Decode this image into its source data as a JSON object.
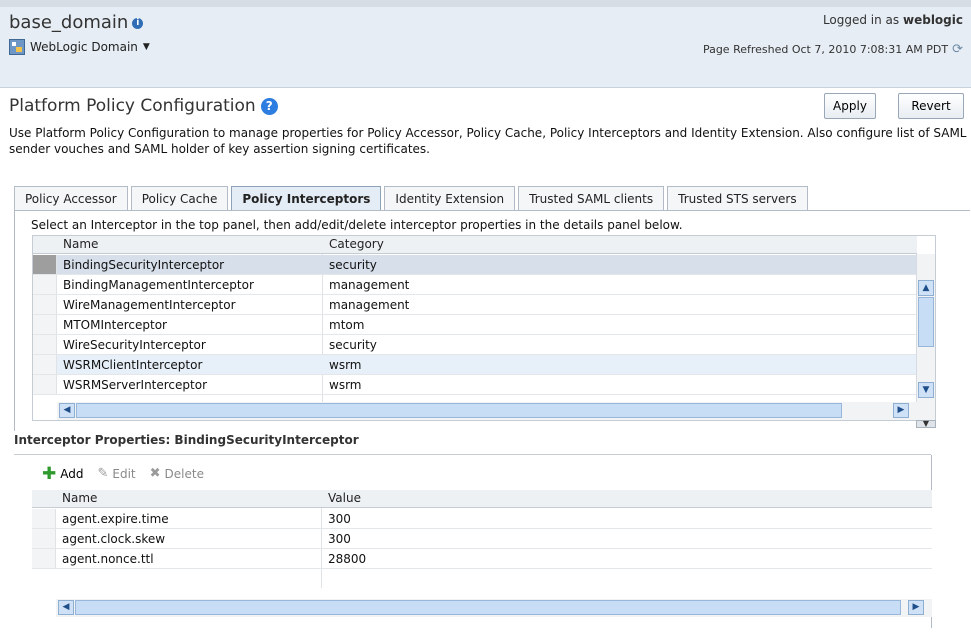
{
  "header": {
    "domain_title": "base_domain",
    "domain_menu_label": "WebLogic Domain",
    "logged_in_prefix": "Logged in as",
    "logged_in_user": "weblogic",
    "page_refreshed": "Page Refreshed Oct 7, 2010 7:08:31 AM PDT"
  },
  "page": {
    "title": "Platform Policy Configuration",
    "apply_label": "Apply",
    "revert_label": "Revert",
    "description": "Use Platform Policy Configuration to manage properties for Policy Accessor, Policy Cache, Policy Interceptors and Identity Extension. Also configure list of SAML sender vouches and SAML holder of key assertion signing certificates."
  },
  "tabs": [
    {
      "label": "Policy Accessor",
      "active": false
    },
    {
      "label": "Policy Cache",
      "active": false
    },
    {
      "label": "Policy Interceptors",
      "active": true
    },
    {
      "label": "Identity Extension",
      "active": false
    },
    {
      "label": "Trusted SAML clients",
      "active": false
    },
    {
      "label": "Trusted STS servers",
      "active": false
    }
  ],
  "interceptors": {
    "instruction": "Select an Interceptor in the top panel, then add/edit/delete interceptor properties in the details panel below.",
    "columns": [
      "Name",
      "Category"
    ],
    "rows": [
      {
        "name": "BindingSecurityInterceptor",
        "category": "security"
      },
      {
        "name": "BindingManagementInterceptor",
        "category": "management"
      },
      {
        "name": "WireManagementInterceptor",
        "category": "management"
      },
      {
        "name": "MTOMInterceptor",
        "category": "mtom"
      },
      {
        "name": "WireSecurityInterceptor",
        "category": "security"
      },
      {
        "name": "WSRMClientInterceptor",
        "category": "wsrm"
      },
      {
        "name": "WSRMServerInterceptor",
        "category": "wsrm"
      }
    ]
  },
  "details": {
    "title": "Interceptor Properties: BindingSecurityInterceptor",
    "toolbar": {
      "add": "Add",
      "edit": "Edit",
      "delete": "Delete"
    },
    "columns": [
      "Name",
      "Value"
    ],
    "rows": [
      {
        "name": "agent.expire.time",
        "value": "300"
      },
      {
        "name": "agent.clock.skew",
        "value": "300"
      },
      {
        "name": "agent.nonce.ttl",
        "value": "28800"
      }
    ]
  },
  "icons": {
    "info": "info-icon",
    "help": "help-icon",
    "refresh": "refresh-icon",
    "domain": "weblogic-domain-icon",
    "add": "add-icon",
    "edit": "edit-pencil-icon",
    "delete": "delete-x-icon"
  },
  "colors": {
    "header_bg": "#e6edf4",
    "selected_row": "#d6dfea",
    "active_tab": "#e4ecf5",
    "add_icon": "#2e9a2e",
    "help_icon": "#2e7de0"
  }
}
